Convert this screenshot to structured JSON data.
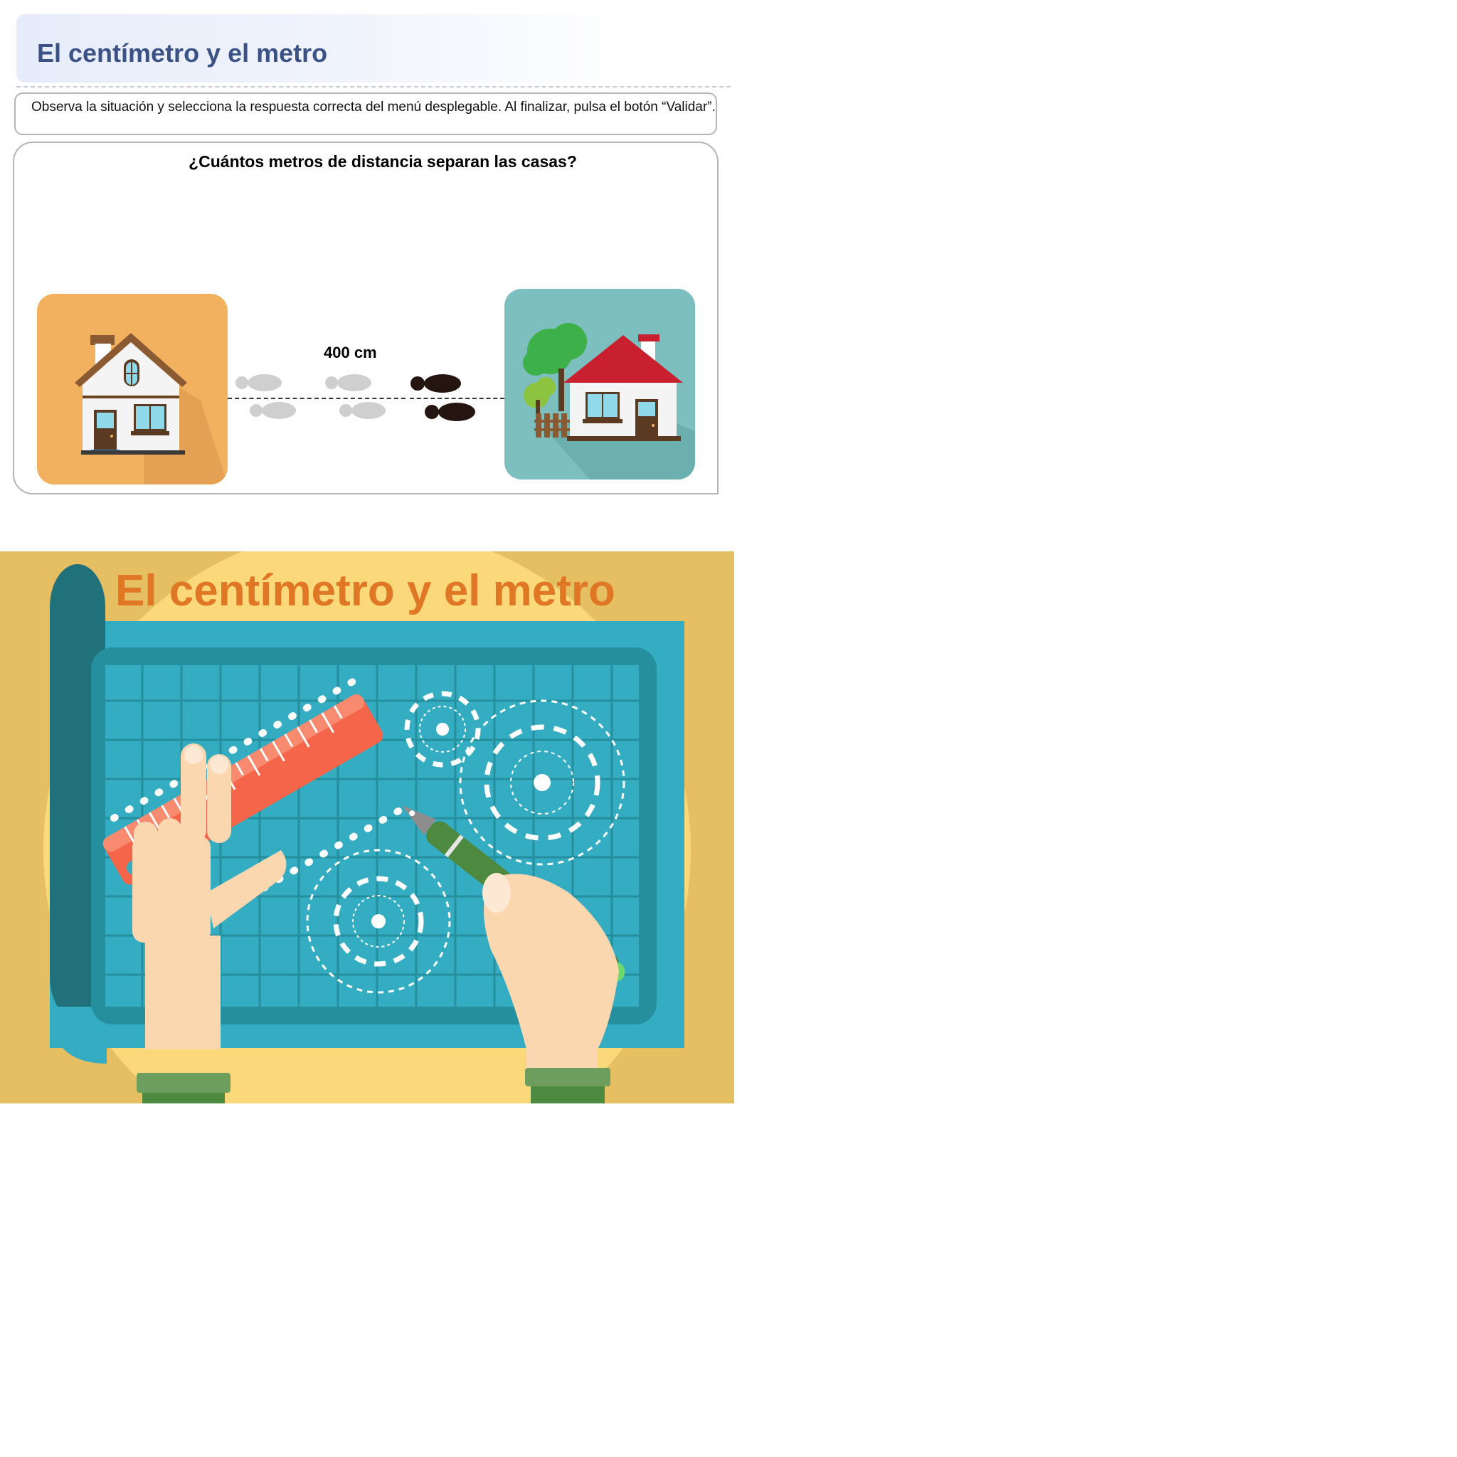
{
  "header": {
    "title": "El centímetro y el metro"
  },
  "instructions": {
    "text": "Observa la situación y selecciona la respuesta correcta del menú desplegable. Al finalizar, pulsa el botón “Validar”."
  },
  "activity": {
    "question": "¿Cuántos metros de distancia separan las casas?",
    "distance_label": "400 cm"
  },
  "banner": {
    "title": "El centímetro y el metro"
  },
  "colors": {
    "header_text": "#3b5286",
    "banner_title": "#e07725",
    "left_card": "#f2b15f",
    "right_card": "#7dbfbf"
  },
  "icons": [
    "house-icon",
    "footprints-icon",
    "ruler-icon",
    "gear-icon",
    "pen-icon",
    "hand-icon"
  ]
}
